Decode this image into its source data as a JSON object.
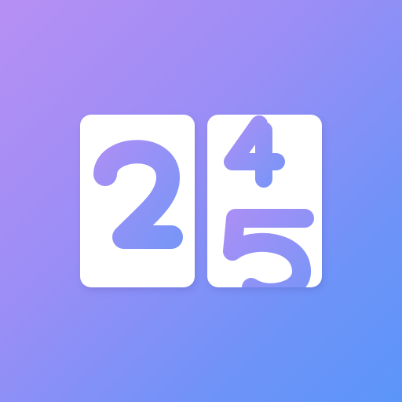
{
  "logo": {
    "digits": [
      "2",
      "4",
      "5"
    ],
    "colors": {
      "background_start": "#b78ff3",
      "background_end": "#5b95f9",
      "tile": "#ffffff",
      "digit": "#8c92f4"
    }
  }
}
